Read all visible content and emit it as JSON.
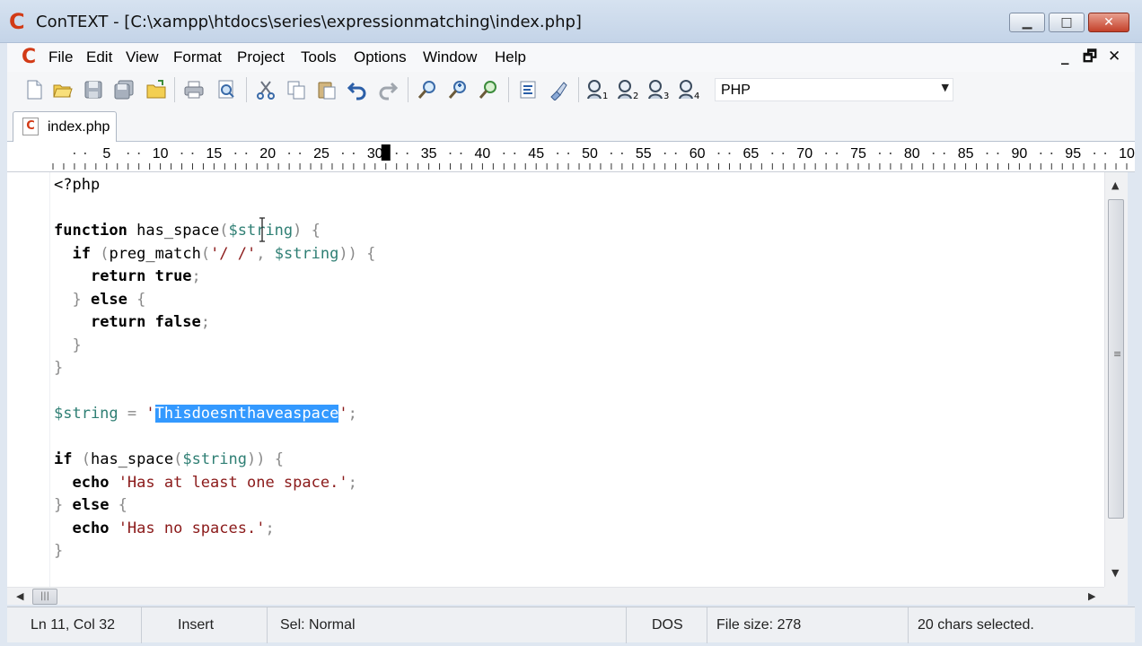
{
  "window": {
    "app_logo": "C",
    "title": "ConTEXT - [C:\\xampp\\htdocs\\series\\expressionmatching\\index.php]",
    "minimize": "▁",
    "maximize": "□",
    "close": "✕"
  },
  "menu": {
    "logo": "C",
    "items": [
      "File",
      "Edit",
      "View",
      "Format",
      "Project",
      "Tools",
      "Options",
      "Window",
      "Help"
    ],
    "mdi_minimize": "_",
    "mdi_restore": "🗗",
    "mdi_close": "✕"
  },
  "toolbar": {
    "icons": [
      "new-file-icon",
      "open-file-icon",
      "save-icon",
      "save-all-icon",
      "open-folder-icon",
      "print-icon",
      "print-preview-icon",
      "cut-icon",
      "copy-icon",
      "paste-icon",
      "undo-icon",
      "redo-icon",
      "find-icon",
      "find-next-icon",
      "replace-icon",
      "format-icon",
      "highlighter-icon",
      "user-tool-1-icon",
      "user-tool-2-icon",
      "user-tool-3-icon",
      "user-tool-4-icon"
    ],
    "language": "PHP"
  },
  "tabs": [
    {
      "label": "index.php",
      "icon": "php-file-icon"
    }
  ],
  "ruler": {
    "labels": [
      "5",
      "10",
      "15",
      "20",
      "25",
      "30",
      "35",
      "40",
      "45",
      "50",
      "55",
      "60",
      "65",
      "70",
      "75",
      "80",
      "85",
      "90",
      "95",
      "10"
    ],
    "cursor_column": 32
  },
  "editor": {
    "lines": [
      [
        {
          "t": "<?php",
          "c": "fn"
        }
      ],
      [],
      [
        {
          "t": "function",
          "c": "kw"
        },
        {
          "t": " has_space",
          "c": "fn"
        },
        {
          "t": "(",
          "c": "punc"
        },
        {
          "t": "$string",
          "c": "var"
        },
        {
          "t": ") {",
          "c": "punc"
        }
      ],
      [
        {
          "t": "  ",
          "c": "fn"
        },
        {
          "t": "if",
          "c": "kw"
        },
        {
          "t": " (",
          "c": "punc"
        },
        {
          "t": "preg_match",
          "c": "fn"
        },
        {
          "t": "(",
          "c": "punc"
        },
        {
          "t": "'/ /'",
          "c": "str"
        },
        {
          "t": ", ",
          "c": "punc"
        },
        {
          "t": "$string",
          "c": "var"
        },
        {
          "t": ")) {",
          "c": "punc"
        }
      ],
      [
        {
          "t": "    ",
          "c": "fn"
        },
        {
          "t": "return true",
          "c": "kw"
        },
        {
          "t": ";",
          "c": "punc"
        }
      ],
      [
        {
          "t": "  } ",
          "c": "punc"
        },
        {
          "t": "else",
          "c": "kw"
        },
        {
          "t": " {",
          "c": "punc"
        }
      ],
      [
        {
          "t": "    ",
          "c": "fn"
        },
        {
          "t": "return false",
          "c": "kw"
        },
        {
          "t": ";",
          "c": "punc"
        }
      ],
      [
        {
          "t": "  }",
          "c": "punc"
        }
      ],
      [
        {
          "t": "}",
          "c": "punc"
        }
      ],
      [],
      [
        {
          "t": "$string",
          "c": "var"
        },
        {
          "t": " = ",
          "c": "punc"
        },
        {
          "t": "'",
          "c": "str"
        },
        {
          "t": "Thisdoesnthaveaspace",
          "c": "sel"
        },
        {
          "t": "'",
          "c": "str"
        },
        {
          "t": ";",
          "c": "punc"
        }
      ],
      [],
      [
        {
          "t": "if",
          "c": "kw"
        },
        {
          "t": " (",
          "c": "punc"
        },
        {
          "t": "has_space",
          "c": "fn"
        },
        {
          "t": "(",
          "c": "punc"
        },
        {
          "t": "$string",
          "c": "var"
        },
        {
          "t": ")) {",
          "c": "punc"
        }
      ],
      [
        {
          "t": "  ",
          "c": "fn"
        },
        {
          "t": "echo",
          "c": "kw"
        },
        {
          "t": " ",
          "c": "fn"
        },
        {
          "t": "'Has at least one space.'",
          "c": "str"
        },
        {
          "t": ";",
          "c": "punc"
        }
      ],
      [
        {
          "t": "} ",
          "c": "punc"
        },
        {
          "t": "else",
          "c": "kw"
        },
        {
          "t": " {",
          "c": "punc"
        }
      ],
      [
        {
          "t": "  ",
          "c": "fn"
        },
        {
          "t": "echo",
          "c": "kw"
        },
        {
          "t": " ",
          "c": "fn"
        },
        {
          "t": "'Has no spaces.'",
          "c": "str"
        },
        {
          "t": ";",
          "c": "punc"
        }
      ],
      [
        {
          "t": "}",
          "c": "punc"
        }
      ]
    ]
  },
  "statusbar": {
    "position": "Ln 11, Col 32",
    "insert_mode": "Insert",
    "selection_mode": "Sel: Normal",
    "line_endings": "DOS",
    "file_size": "File size: 278",
    "selection_info": "20 chars selected."
  },
  "colors": {
    "keyword": "#000000",
    "variable": "#2f7f74",
    "string": "#8b1a1a",
    "selection": "#3399ff",
    "logo": "#d23a16"
  }
}
